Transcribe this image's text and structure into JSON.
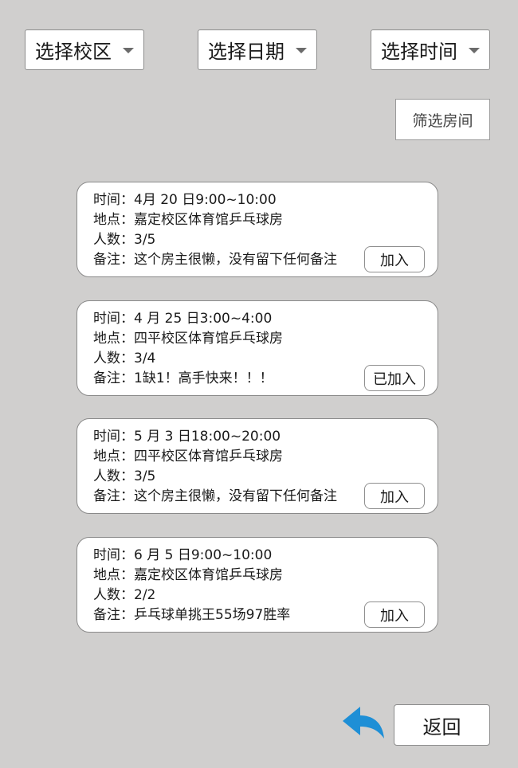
{
  "filters": {
    "campus": "选择校区",
    "date": "选择日期",
    "time": "选择时间",
    "filter_button": "筛选房间"
  },
  "rooms": [
    {
      "time": "时间：4月 20 日9:00~10:00",
      "location": "地点：嘉定校区体育馆乒乓球房",
      "people": "人数：3/5",
      "note": "备注：这个房主很懒，没有留下任何备注",
      "button": "加入"
    },
    {
      "time": "时间：4 月 25 日3:00~4:00",
      "location": "地点：四平校区体育馆乒乓球房",
      "people": "人数：3/4",
      "note": "备注：1缺1！高手快来！！！",
      "button": "已加入"
    },
    {
      "time": "时间：5 月 3 日18:00~20:00",
      "location": "地点：四平校区体育馆乒乓球房",
      "people": "人数：3/5",
      "note": "备注：这个房主很懒，没有留下任何备注",
      "button": "加入"
    },
    {
      "time": "时间：6 月 5 日9:00~10:00",
      "location": "地点：嘉定校区体育馆乒乓球房",
      "people": "人数：2/2",
      "note": "备注：乒乓球单挑王55场97胜率",
      "button": "加入"
    }
  ],
  "footer": {
    "back_icon": "undo-arrow-icon",
    "back_label": "返回",
    "icon_color": "#1e8fd6"
  }
}
